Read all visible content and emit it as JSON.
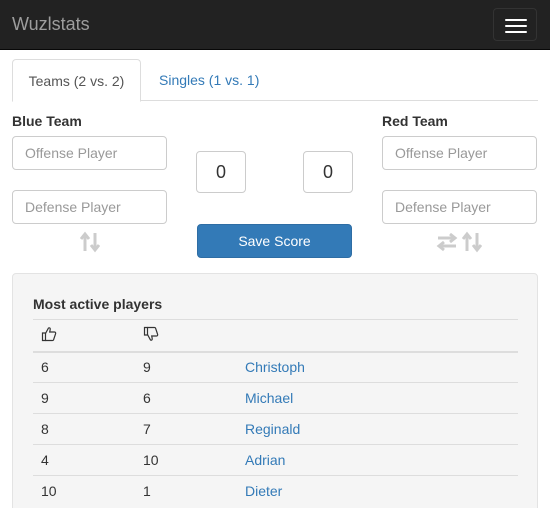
{
  "navbar": {
    "brand": "Wuzlstats",
    "toggle_icon": "hamburger-menu-icon"
  },
  "tabs": [
    {
      "label": "Teams (2 vs. 2)",
      "active": true
    },
    {
      "label": "Singles (1 vs. 1)",
      "active": false
    }
  ],
  "blue_team": {
    "label": "Blue Team",
    "offense_placeholder": "Offense Player",
    "defense_placeholder": "Defense Player",
    "swap_icon": "swap-vertical-icon"
  },
  "red_team": {
    "label": "Red Team",
    "offense_placeholder": "Offense Player",
    "defense_placeholder": "Defense Player",
    "switch_icon": "swap-horizontal-icon",
    "swap_icon": "swap-vertical-icon"
  },
  "scores": {
    "blue": "0",
    "red": "0"
  },
  "save_button": "Save Score",
  "active_players": {
    "title": "Most active players",
    "header_icons": [
      "thumbs-up-icon",
      "thumbs-down-icon"
    ],
    "rows": [
      {
        "wins": "6",
        "losses": "9",
        "name": "Christoph"
      },
      {
        "wins": "9",
        "losses": "6",
        "name": "Michael"
      },
      {
        "wins": "8",
        "losses": "7",
        "name": "Reginald"
      },
      {
        "wins": "4",
        "losses": "10",
        "name": "Adrian"
      },
      {
        "wins": "10",
        "losses": "1",
        "name": "Dieter"
      }
    ]
  },
  "colors": {
    "navbar": "#222222",
    "link": "#337ab7",
    "primary_button": "#337ab7",
    "panel": "#f5f5f5"
  }
}
